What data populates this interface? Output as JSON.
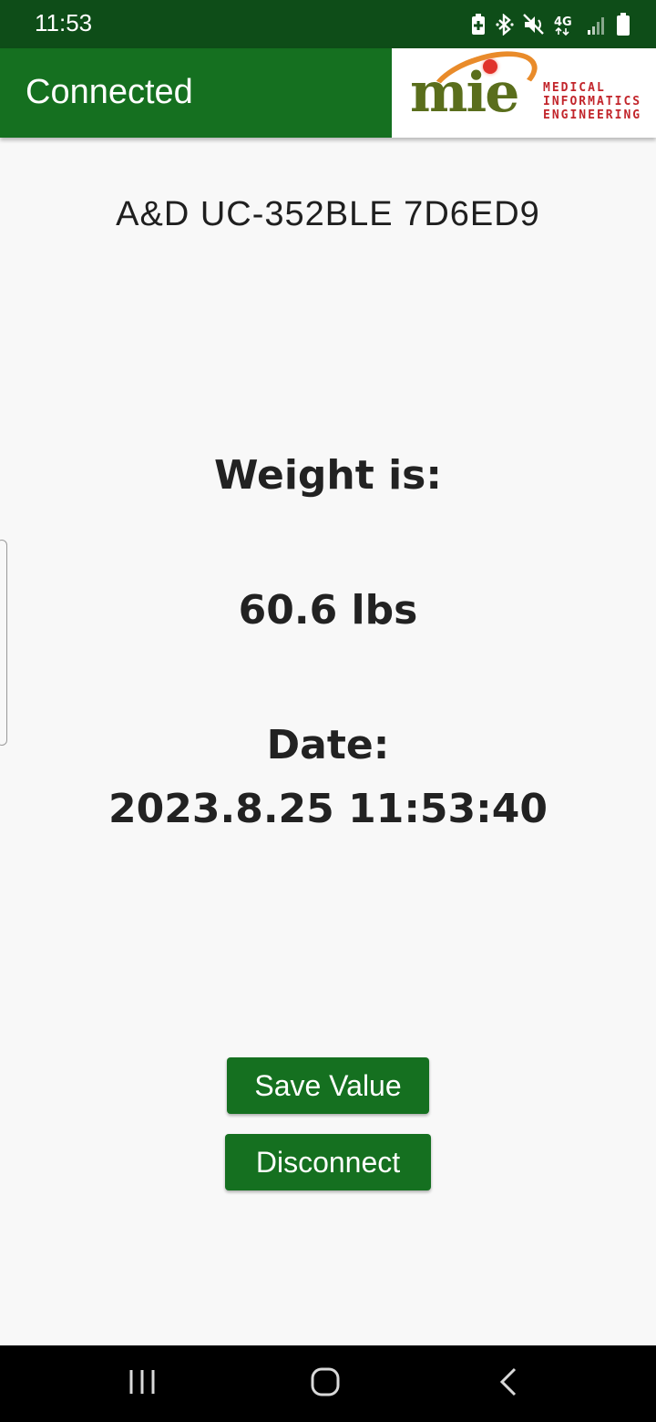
{
  "status_bar": {
    "time": "11:53",
    "icons": [
      "battery-saver-icon",
      "bluetooth-icon",
      "mute-icon",
      "4g-icon",
      "signal-icon",
      "battery-icon"
    ],
    "network_label": "4G"
  },
  "app_bar": {
    "title": "Connected",
    "logo": {
      "wordmark": "mie",
      "text_lines": [
        "MEDICAL",
        "INFORMATICS",
        "ENGINEERING"
      ],
      "colors": {
        "wordmark": "#5a6e1c",
        "arc": "#e98b2a",
        "dot": "#e0322a",
        "text": "#c2252b"
      }
    }
  },
  "device": {
    "name": "A&D UC-352BLE 7D6ED9"
  },
  "reading": {
    "weight_label": "Weight is:",
    "weight_value": "60.6 lbs",
    "date_label": "Date:",
    "date_value": "2023.8.25 11:53:40"
  },
  "actions": {
    "save_label": "Save Value",
    "disconnect_label": "Disconnect"
  },
  "nav_bar": {
    "icons": [
      "recents-icon",
      "home-icon",
      "back-icon"
    ]
  },
  "colors": {
    "status_bar": "#0e4d18",
    "primary": "#157020",
    "background": "#f8f8f8",
    "text": "#222222"
  }
}
